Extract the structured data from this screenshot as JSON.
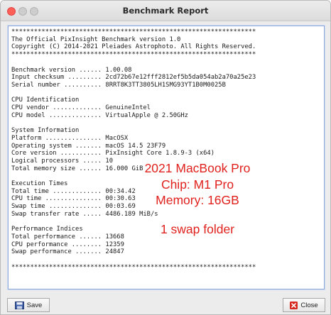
{
  "window": {
    "title": "Benchmark Report"
  },
  "report": {
    "lines": [
      "*****************************************************************",
      "The Official PixInsight Benchmark version 1.0",
      "Copyright (C) 2014-2021 Pleiades Astrophoto. All Rights Reserved.",
      "*****************************************************************",
      "",
      "Benchmark version ...... 1.00.08",
      "Input checksum ......... 2cd72b67e12fff2812ef5b5da054ab2a70a25e23",
      "Serial number .......... 8RRT8K3TT3805LH1SMG93YT1B0M0025B",
      "",
      "CPU Identification",
      "CPU vendor ............. GenuineIntel",
      "CPU model .............. VirtualApple @ 2.50GHz",
      "",
      "System Information",
      "Platform ............... MacOSX",
      "Operating system ....... macOS 14.5 23F79",
      "Core version ........... PixInsight Core 1.8.9-3 (x64)",
      "Logical processors ..... 10",
      "Total memory size ...... 16.000 GiB",
      "",
      "Execution Times",
      "Total time ............. 00:34.42",
      "CPU time ............... 00:30.63",
      "Swap time .............. 00:03.69",
      "Swap transfer rate ..... 4486.189 MiB/s",
      "",
      "Performance Indices",
      "Total performance ...... 13668",
      "CPU performance ........ 12359",
      "Swap performance ....... 24847",
      "",
      "*****************************************************************"
    ]
  },
  "annotation": {
    "line1": "2021 MacBook Pro",
    "line2": "Chip: M1 Pro",
    "line3": "Memory: 16GB",
    "line4": "1 swap folder",
    "color": "#e0211d"
  },
  "buttons": {
    "save_label": "Save",
    "close_label": "Close"
  },
  "icons": {
    "save": "floppy-disk-icon",
    "close": "red-x-icon"
  }
}
